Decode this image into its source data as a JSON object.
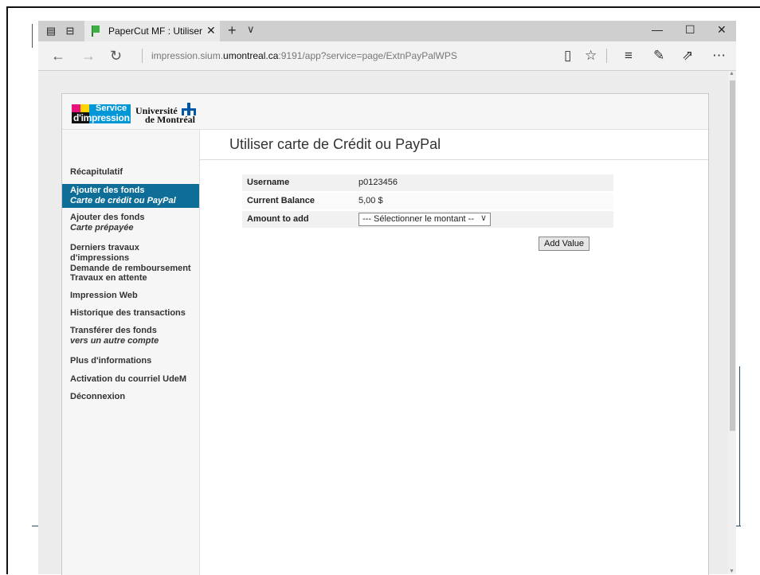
{
  "browser": {
    "tab_title": "PaperCut MF : Utiliser ca",
    "tab_close": "✕",
    "new_tab": "+",
    "tab_list": "∨",
    "url_prefix": "impression.sium.",
    "url_domain": "umontreal.ca",
    "url_suffix": ":9191/app?service=page/ExtnPayPalWPS",
    "icons": [
      "tab-set-aside-icon",
      "tabs-preview-icon",
      "favicon-flag-icon",
      "back-arrow-icon",
      "forward-arrow-icon",
      "refresh-icon",
      "reading-view-icon",
      "favorite-star-icon",
      "hub-icon",
      "web-note-icon",
      "share-icon",
      "more-icon",
      "minimize-icon",
      "maximize-icon",
      "close-icon"
    ]
  },
  "brand": {
    "service_top": "Service",
    "service_bottom": "d'impression",
    "university_line1": "Université",
    "university_line2": "de Montréal",
    "colors": {
      "magenta": "#e8127c",
      "yellow": "#ffd400",
      "blue": "#0097d6",
      "udem_blue": "#0057a8"
    }
  },
  "sidebar": {
    "active_color": "#0f6e98",
    "items": [
      {
        "label": "Récapitulatif",
        "sub": ""
      },
      {
        "label": "Ajouter des fonds",
        "sub": "Carte de crédit ou PayPal"
      },
      {
        "label": "Ajouter des fonds",
        "sub": "Carte prépayée"
      },
      {
        "label": "Derniers travaux d'impressions",
        "sub2": "Demande de remboursement"
      },
      {
        "label": "Travaux en attente",
        "sub": ""
      },
      {
        "label": "Impression Web",
        "sub": ""
      },
      {
        "label": "Historique des transactions",
        "sub": ""
      },
      {
        "label": "Transférer des fonds",
        "sub": "vers un autre compte"
      },
      {
        "label": "Plus d'informations",
        "sub": ""
      },
      {
        "label": "Activation du courriel UdeM",
        "sub": ""
      },
      {
        "label": "Déconnexion",
        "sub": ""
      }
    ]
  },
  "main": {
    "title": "Utiliser carte de Crédit ou PayPal",
    "form": {
      "username_label": "Username",
      "username_value": "p0123456",
      "balance_label": "Current Balance",
      "balance_value": "5,00 $",
      "amount_label": "Amount to add",
      "amount_selected": "--- Sélectionner le montant --"
    },
    "add_value_label": "Add Value"
  }
}
